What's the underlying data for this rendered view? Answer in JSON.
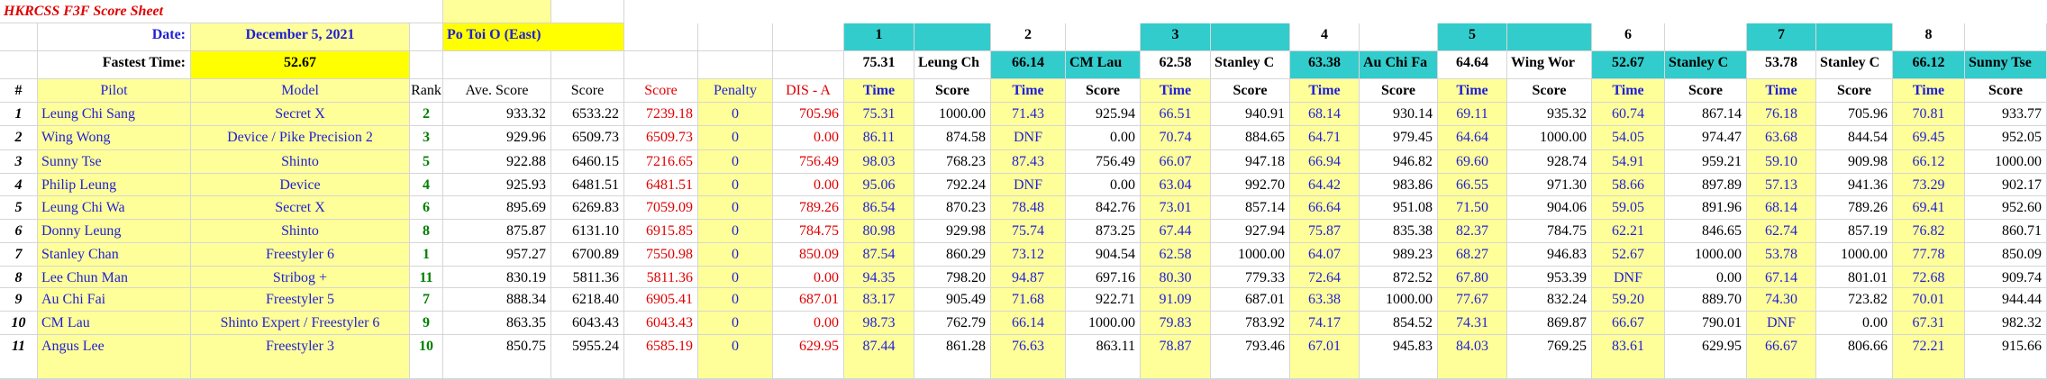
{
  "sheet_title": "HKRCSS F3F Score Sheet",
  "date_label": "Date:",
  "date_value": "December 5, 2021",
  "location": "Po Toi O (East)",
  "fastest_label": "Fastest Time:",
  "fastest_value": "52.67",
  "rounds": [
    {
      "num": "1",
      "fastest": "75.31",
      "leader": "Leung Ch"
    },
    {
      "num": "2",
      "fastest": "66.14",
      "leader": "CM Lau"
    },
    {
      "num": "3",
      "fastest": "62.58",
      "leader": "Stanley C"
    },
    {
      "num": "4",
      "fastest": "63.38",
      "leader": "Au Chi Fa"
    },
    {
      "num": "5",
      "fastest": "64.64",
      "leader": "Wing Wor"
    },
    {
      "num": "6",
      "fastest": "52.67",
      "leader": "Stanley C"
    },
    {
      "num": "7",
      "fastest": "53.78",
      "leader": "Stanley C"
    },
    {
      "num": "8",
      "fastest": "66.12",
      "leader": "Sunny Tse"
    }
  ],
  "headers": {
    "num": "#",
    "pilot": "Pilot",
    "model": "Model",
    "rank": "Rank",
    "ave": "Ave. Score",
    "score": "Score",
    "score_red": "Score",
    "penalty": "Penalty",
    "dis": "DIS - A",
    "time": "Time",
    "round_score": "Score"
  },
  "colors": {
    "yellow": "#ffff99",
    "bright_yellow": "#ffff00",
    "teal": "#33cccc",
    "blue": "#1f1fd6",
    "red": "#e00000",
    "green": "#008000"
  },
  "rows": [
    {
      "num": "1",
      "pilot": "Leung Chi Sang",
      "model": "Secret X",
      "rank": "2",
      "ave": "933.32",
      "score": "6533.22",
      "score_red": "7239.18",
      "penalty": "0",
      "dis": "705.96",
      "r": [
        [
          "75.31",
          "1000.00"
        ],
        [
          "71.43",
          "925.94"
        ],
        [
          "66.51",
          "940.91"
        ],
        [
          "68.14",
          "930.14"
        ],
        [
          "69.11",
          "935.32"
        ],
        [
          "60.74",
          "867.14"
        ],
        [
          "76.18",
          "705.96"
        ],
        [
          "70.81",
          "933.77"
        ]
      ]
    },
    {
      "num": "2",
      "pilot": "Wing Wong",
      "model": "Device / Pike Precision 2",
      "rank": "3",
      "ave": "929.96",
      "score": "6509.73",
      "score_red": "6509.73",
      "penalty": "0",
      "dis": "0.00",
      "r": [
        [
          "86.11",
          "874.58"
        ],
        [
          "DNF",
          "0.00"
        ],
        [
          "70.74",
          "884.65"
        ],
        [
          "64.71",
          "979.45"
        ],
        [
          "64.64",
          "1000.00"
        ],
        [
          "54.05",
          "974.47"
        ],
        [
          "63.68",
          "844.54"
        ],
        [
          "69.45",
          "952.05"
        ]
      ]
    },
    {
      "num": "3",
      "pilot": "Sunny Tse",
      "model": "Shinto",
      "rank": "5",
      "ave": "922.88",
      "score": "6460.15",
      "score_red": "7216.65",
      "penalty": "0",
      "dis": "756.49",
      "r": [
        [
          "98.03",
          "768.23"
        ],
        [
          "87.43",
          "756.49"
        ],
        [
          "66.07",
          "947.18"
        ],
        [
          "66.94",
          "946.82"
        ],
        [
          "69.60",
          "928.74"
        ],
        [
          "54.91",
          "959.21"
        ],
        [
          "59.10",
          "909.98"
        ],
        [
          "66.12",
          "1000.00"
        ]
      ]
    },
    {
      "num": "4",
      "pilot": "Philip Leung",
      "model": "Device",
      "rank": "4",
      "ave": "925.93",
      "score": "6481.51",
      "score_red": "6481.51",
      "penalty": "0",
      "dis": "0.00",
      "r": [
        [
          "95.06",
          "792.24"
        ],
        [
          "DNF",
          "0.00"
        ],
        [
          "63.04",
          "992.70"
        ],
        [
          "64.42",
          "983.86"
        ],
        [
          "66.55",
          "971.30"
        ],
        [
          "58.66",
          "897.89"
        ],
        [
          "57.13",
          "941.36"
        ],
        [
          "73.29",
          "902.17"
        ]
      ]
    },
    {
      "num": "5",
      "pilot": "Leung Chi Wa",
      "model": "Secret X",
      "rank": "6",
      "ave": "895.69",
      "score": "6269.83",
      "score_red": "7059.09",
      "penalty": "0",
      "dis": "789.26",
      "r": [
        [
          "86.54",
          "870.23"
        ],
        [
          "78.48",
          "842.76"
        ],
        [
          "73.01",
          "857.14"
        ],
        [
          "66.64",
          "951.08"
        ],
        [
          "71.50",
          "904.06"
        ],
        [
          "59.05",
          "891.96"
        ],
        [
          "68.14",
          "789.26"
        ],
        [
          "69.41",
          "952.60"
        ]
      ]
    },
    {
      "num": "6",
      "pilot": "Donny Leung",
      "model": "Shinto",
      "rank": "8",
      "ave": "875.87",
      "score": "6131.10",
      "score_red": "6915.85",
      "penalty": "0",
      "dis": "784.75",
      "r": [
        [
          "80.98",
          "929.98"
        ],
        [
          "75.74",
          "873.25"
        ],
        [
          "67.44",
          "927.94"
        ],
        [
          "75.87",
          "835.38"
        ],
        [
          "82.37",
          "784.75"
        ],
        [
          "62.21",
          "846.65"
        ],
        [
          "62.74",
          "857.19"
        ],
        [
          "76.82",
          "860.71"
        ]
      ]
    },
    {
      "num": "7",
      "pilot": "Stanley Chan",
      "model": "Freestyler 6",
      "rank": "1",
      "ave": "957.27",
      "score": "6700.89",
      "score_red": "7550.98",
      "penalty": "0",
      "dis": "850.09",
      "r": [
        [
          "87.54",
          "860.29"
        ],
        [
          "73.12",
          "904.54"
        ],
        [
          "62.58",
          "1000.00"
        ],
        [
          "64.07",
          "989.23"
        ],
        [
          "68.27",
          "946.83"
        ],
        [
          "52.67",
          "1000.00"
        ],
        [
          "53.78",
          "1000.00"
        ],
        [
          "77.78",
          "850.09"
        ]
      ]
    },
    {
      "num": "8",
      "pilot": "Lee Chun Man",
      "model": "Stribog +",
      "rank": "11",
      "ave": "830.19",
      "score": "5811.36",
      "score_red": "5811.36",
      "penalty": "0",
      "dis": "0.00",
      "r": [
        [
          "94.35",
          "798.20"
        ],
        [
          "94.87",
          "697.16"
        ],
        [
          "80.30",
          "779.33"
        ],
        [
          "72.64",
          "872.52"
        ],
        [
          "67.80",
          "953.39"
        ],
        [
          "DNF",
          "0.00"
        ],
        [
          "67.14",
          "801.01"
        ],
        [
          "72.68",
          "909.74"
        ]
      ]
    },
    {
      "num": "9",
      "pilot": "Au Chi Fai",
      "model": "Freestyler 5",
      "rank": "7",
      "ave": "888.34",
      "score": "6218.40",
      "score_red": "6905.41",
      "penalty": "0",
      "dis": "687.01",
      "r": [
        [
          "83.17",
          "905.49"
        ],
        [
          "71.68",
          "922.71"
        ],
        [
          "91.09",
          "687.01"
        ],
        [
          "63.38",
          "1000.00"
        ],
        [
          "77.67",
          "832.24"
        ],
        [
          "59.20",
          "889.70"
        ],
        [
          "74.30",
          "723.82"
        ],
        [
          "70.01",
          "944.44"
        ]
      ]
    },
    {
      "num": "10",
      "pilot": "CM Lau",
      "model": "Shinto Expert / Freestyler 6",
      "rank": "9",
      "ave": "863.35",
      "score": "6043.43",
      "score_red": "6043.43",
      "penalty": "0",
      "dis": "0.00",
      "r": [
        [
          "98.73",
          "762.79"
        ],
        [
          "66.14",
          "1000.00"
        ],
        [
          "79.83",
          "783.92"
        ],
        [
          "74.17",
          "854.52"
        ],
        [
          "74.31",
          "869.87"
        ],
        [
          "66.67",
          "790.01"
        ],
        [
          "DNF",
          "0.00"
        ],
        [
          "67.31",
          "982.32"
        ]
      ]
    },
    {
      "num": "11",
      "pilot": "Angus Lee",
      "model": "Freestyler 3",
      "rank": "10",
      "ave": "850.75",
      "score": "5955.24",
      "score_red": "6585.19",
      "penalty": "0",
      "dis": "629.95",
      "r": [
        [
          "87.44",
          "861.28"
        ],
        [
          "76.63",
          "863.11"
        ],
        [
          "78.87",
          "793.46"
        ],
        [
          "67.01",
          "945.83"
        ],
        [
          "84.03",
          "769.25"
        ],
        [
          "83.61",
          "629.95"
        ],
        [
          "66.67",
          "806.66"
        ],
        [
          "72.21",
          "915.66"
        ]
      ]
    }
  ]
}
